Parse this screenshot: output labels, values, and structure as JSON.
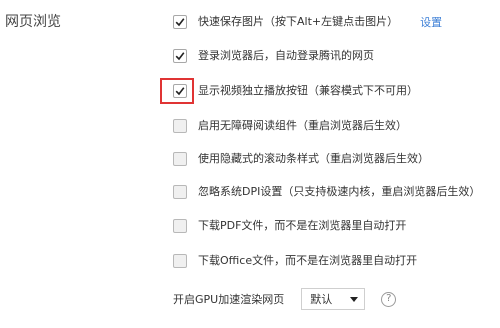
{
  "section": {
    "title": "网页浏览"
  },
  "options": [
    {
      "label": "快速保存图片（按下Alt+左键点击图片）",
      "checked": true,
      "link": "设置"
    },
    {
      "label": "登录浏览器后，自动登录腾讯的网页",
      "checked": true
    },
    {
      "label": "显示视频独立播放按钮（兼容模式下不可用）",
      "checked": true,
      "highlighted": true
    },
    {
      "label": "启用无障碍阅读组件（重启浏览器后生效）",
      "checked": false
    },
    {
      "label": "使用隐藏式的滚动条样式（重启浏览器后生效）",
      "checked": false
    },
    {
      "label": "忽略系统DPI设置（只支持极速内核，重启浏览器后生效）",
      "checked": false
    },
    {
      "label": "下载PDF文件，而不是在浏览器里自动打开",
      "checked": false
    },
    {
      "label": "下载Office文件，而不是在浏览器里自动打开",
      "checked": false
    }
  ],
  "gpu": {
    "label": "开启GPU加速渲染网页",
    "selected": "默认",
    "help_glyph": "?"
  },
  "colors": {
    "link": "#3d7fd6",
    "highlight_border": "#e03434",
    "checkmark": "#222222"
  }
}
